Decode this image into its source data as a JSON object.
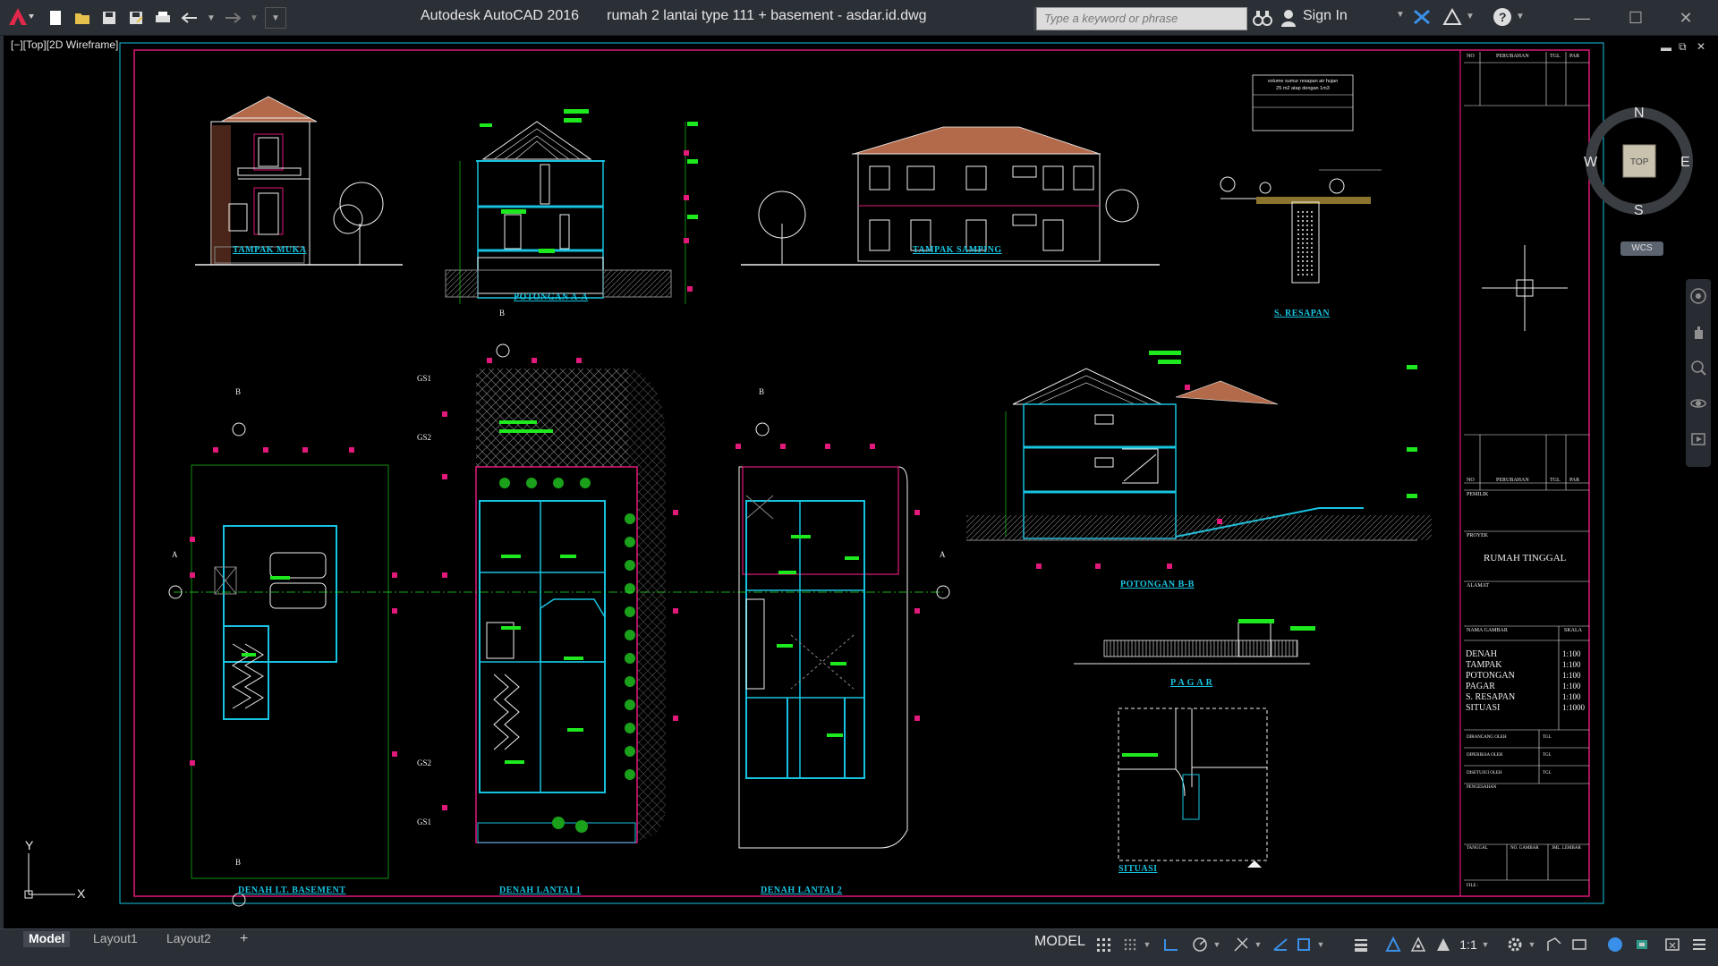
{
  "app": {
    "name": "Autodesk AutoCAD 2016",
    "document": "rumah 2 lantai type 111 + basement - asdar.id.dwg",
    "search_placeholder": "Type a keyword or phrase",
    "sign_in": "Sign In"
  },
  "viewport": {
    "label": "[−][Top][2D Wireframe]",
    "viewcube": {
      "north": "N",
      "south": "S",
      "east": "E",
      "west": "W",
      "face": "TOP",
      "wcs": "WCS"
    },
    "ucs": {
      "x": "X",
      "y": "Y"
    }
  },
  "drawing": {
    "labels": {
      "tampak_muka": "TAMPAK MUKA",
      "potongan_aa": "POTONGAN A-A",
      "tampak_samping": "TAMPAK SAMPING",
      "s_resapan": "S. RESAPAN",
      "potongan_bb": "POTONGAN B-B",
      "pagar": "P A G A R",
      "denah_basement": "DENAH LT. BASEMENT",
      "denah_lantai1": "DENAH LANTAI 1",
      "denah_lantai2": "DENAH LANTAI 2",
      "situasi": "SITUASI"
    },
    "resapan_note": [
      "volume sumur resapan air hujan",
      "25 m2 atap dengan 1m3"
    ],
    "grid_markers": [
      "GS1",
      "GS2",
      "GS2",
      "GS1"
    ],
    "grid_bubbles": [
      "A",
      "A",
      "B",
      "B",
      "B",
      "B"
    ]
  },
  "title_block": {
    "header_cols": [
      "NO",
      "PERUBAHAN",
      "TGL",
      "PAR"
    ],
    "header_cols_2": [
      "NO",
      "PERUBAHAN",
      "TGL",
      "PAR"
    ],
    "pemilik": "PEMILIK",
    "proyek_label": "PROYEK",
    "proyek": "RUMAH TINGGAL",
    "alamat": "ALAMAT",
    "nama_gambar": "NAMA GAMBAR",
    "skala": "SKALA",
    "sheets": [
      {
        "name": "DENAH",
        "scale": "1:100"
      },
      {
        "name": "TAMPAK",
        "scale": "1:100"
      },
      {
        "name": "POTONGAN",
        "scale": "1:100"
      },
      {
        "name": "PAGAR",
        "scale": "1:100"
      },
      {
        "name": "S. RESAPAN",
        "scale": "1:100"
      },
      {
        "name": "SITUASI",
        "scale": "1:1000"
      }
    ],
    "dirancang": "DIRANCANG OLEH",
    "diperiksa": "DIPERIKSA OLEH",
    "disetujui": "DISETUJUI OLEH",
    "tgl": "TGL",
    "pengesahan": "PENGESAHAN",
    "tanggal": "TANGGAL",
    "no_gambar": "NO. GAMBAR",
    "jml_lembar": "JML. LEMBAR",
    "file": "FILE :"
  },
  "status": {
    "tabs": [
      "Model",
      "Layout1",
      "Layout2"
    ],
    "add_tab": "+",
    "model_button": "MODEL",
    "scale": "1:1"
  },
  "colors": {
    "frame": "#e0197a",
    "cyan": "#17c3e0",
    "green": "#1ee81e",
    "magenta": "#e0197a",
    "white": "#f0f0f0",
    "brown": "#b36a4a"
  }
}
